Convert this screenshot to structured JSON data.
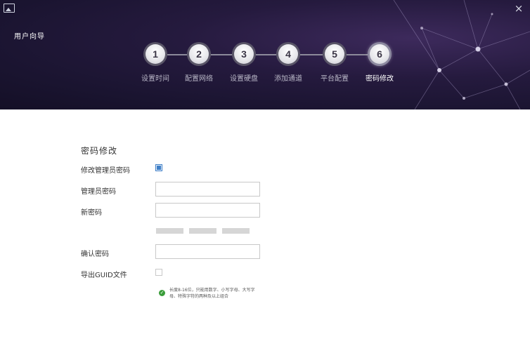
{
  "window": {
    "title": "用户向导",
    "close_glyph": "×"
  },
  "steps": [
    {
      "number": "1",
      "label": "设置时间",
      "active": false
    },
    {
      "number": "2",
      "label": "配置网络",
      "active": false
    },
    {
      "number": "3",
      "label": "设置硬盘",
      "active": false
    },
    {
      "number": "4",
      "label": "添加通道",
      "active": false
    },
    {
      "number": "5",
      "label": "平台配置",
      "active": false
    },
    {
      "number": "6",
      "label": "密码修改",
      "active": true
    }
  ],
  "form": {
    "section_title": "密码修改",
    "modify_admin_label": "修改管理员密码",
    "modify_admin_checked": true,
    "admin_password_label": "管理员密码",
    "admin_password_value": "",
    "new_password_label": "新密码",
    "new_password_value": "",
    "confirm_password_label": "确认密码",
    "confirm_password_value": "",
    "export_guid_label": "导出GUID文件",
    "export_guid_checked": false,
    "hint": "长度8-16位，只能用数字、小写字母、大写字母、特殊字符的两种及以上组合"
  },
  "colors": {
    "header_bg": "#1e1634",
    "accent_check": "#3f7fc7",
    "hint_ok": "#3a9d3a"
  }
}
